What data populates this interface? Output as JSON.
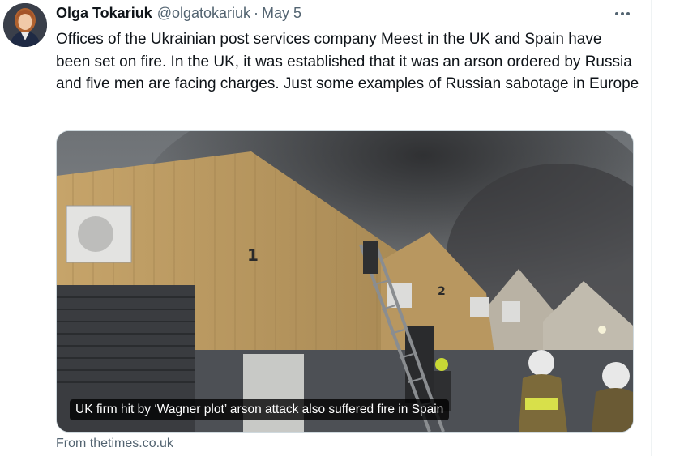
{
  "tweet": {
    "author_name": "Olga Tokariuk",
    "handle": "@olgatokariuk",
    "separator": "·",
    "date": "May 5",
    "text": "Offices of the Ukrainian post services company Meest in the UK and Spain have been set on fire. In the UK, it was established that it was an arson ordered by Russia and five men are facing charges. Just some examples of Russian sabotage in Europe",
    "media": {
      "caption": "UK firm hit by ‘Wagner plot’ arson attack also suffered fire in Spain",
      "building_numbers": [
        "1",
        "2"
      ]
    },
    "source": "From thetimes.co.uk"
  },
  "colors": {
    "text_primary": "#0f1419",
    "text_secondary": "#536471",
    "border": "#cfd9de"
  },
  "icons": {
    "more": "more-horizontal-icon"
  }
}
